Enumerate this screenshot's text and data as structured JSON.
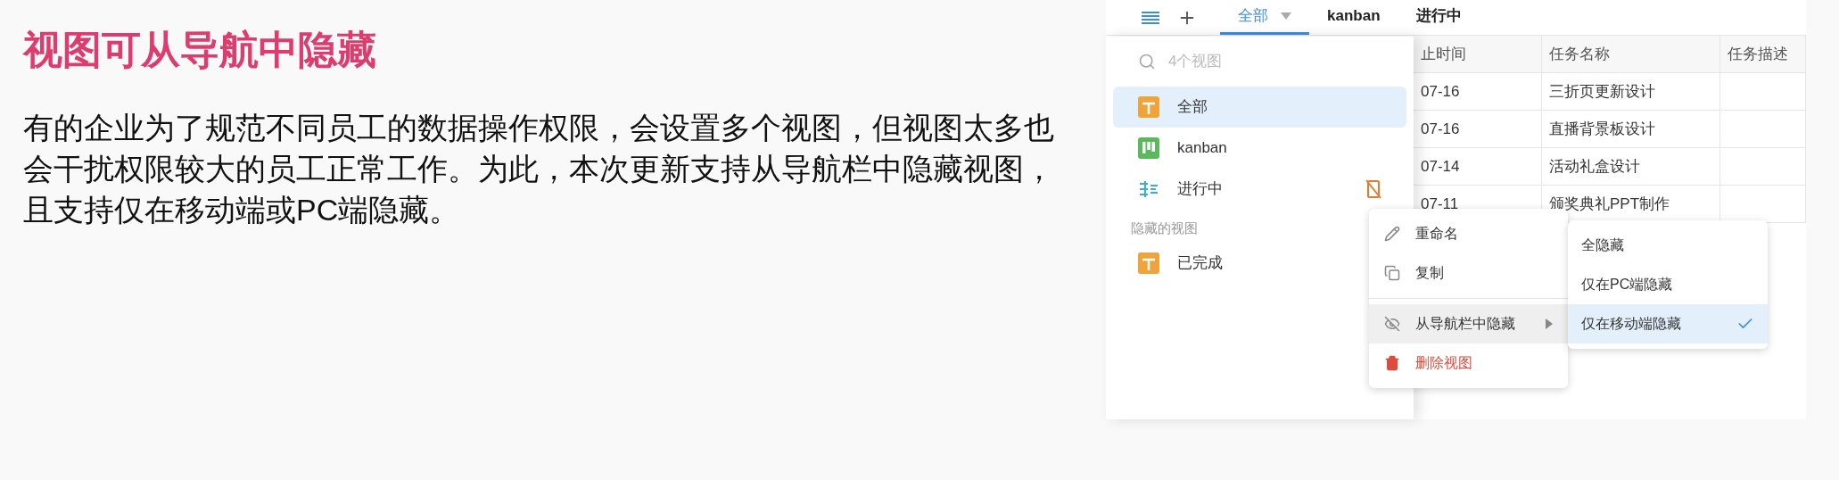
{
  "heading": "视图可从导航中隐藏",
  "paragraph": "有的企业为了规范不同员工的数据操作权限，会设置多个视图，但视图太多也会干扰权限较大的员工正常工作。为此，本次更新支持从导航栏中隐藏视图，且支持仅在移动端或PC端隐藏。",
  "app": {
    "tabs": [
      {
        "label": "全部",
        "selected": true
      },
      {
        "label": "kanban",
        "selected": false
      },
      {
        "label": "进行中",
        "selected": false
      }
    ],
    "search": {
      "placeholder": "4个视图"
    },
    "views": [
      {
        "label": "全部",
        "kind": "grid",
        "selected": true,
        "hidden_on_mobile": false
      },
      {
        "label": "kanban",
        "kind": "kanban",
        "selected": false,
        "hidden_on_mobile": false
      },
      {
        "label": "进行中",
        "kind": "gantt",
        "selected": false,
        "hidden_on_mobile": true
      }
    ],
    "hidden_section_label": "隐藏的视图",
    "hidden_views": [
      {
        "label": "已完成",
        "kind": "grid",
        "selected": false,
        "hidden_on_mobile": false
      }
    ],
    "table": {
      "columns": [
        "止时间",
        "任务名称",
        "任务描述"
      ],
      "rows": [
        [
          "07-16",
          "三折页更新设计",
          ""
        ],
        [
          "07-16",
          "直播背景板设计",
          ""
        ],
        [
          "07-14",
          "活动礼盒设计",
          ""
        ],
        [
          "07-11",
          "颁奖典礼PPT制作",
          ""
        ]
      ]
    },
    "context_menu": [
      {
        "label": "重命名",
        "kind": "rename",
        "selected": false
      },
      {
        "label": "复制",
        "kind": "copy",
        "selected": false
      },
      {
        "label": "从导航栏中隐藏",
        "kind": "hide",
        "selected": true
      },
      {
        "label": "删除视图",
        "kind": "delete",
        "selected": false
      }
    ],
    "submenu": [
      {
        "label": "全隐藏",
        "selected": false
      },
      {
        "label": "仅在PC端隐藏",
        "selected": false
      },
      {
        "label": "仅在移动端隐藏",
        "selected": true
      }
    ]
  }
}
